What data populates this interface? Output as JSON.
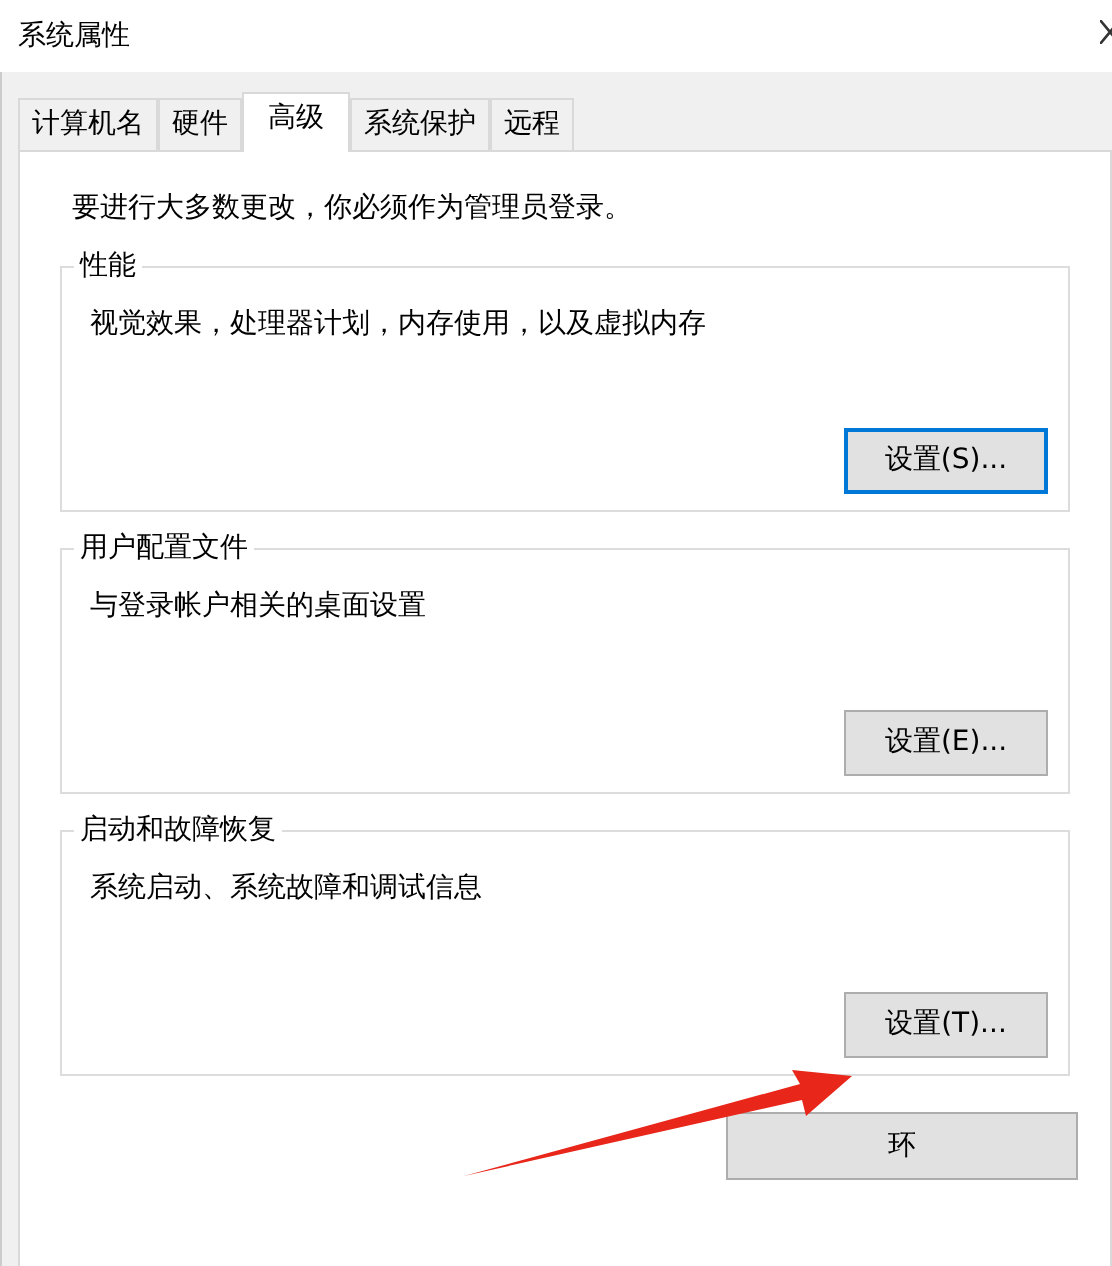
{
  "window": {
    "title": "系统属性"
  },
  "tabs": [
    {
      "label": "计算机名",
      "selected": false
    },
    {
      "label": "硬件",
      "selected": false
    },
    {
      "label": "高级",
      "selected": true
    },
    {
      "label": "系统保护",
      "selected": false
    },
    {
      "label": "远程",
      "selected": false
    }
  ],
  "notice": "要进行大多数更改，你必须作为管理员登录。",
  "groups": [
    {
      "title": "性能",
      "description": "视觉效果，处理器计划，内存使用，以及虚拟内存",
      "button": {
        "label": "设置(S)...",
        "focused": true
      }
    },
    {
      "title": "用户配置文件",
      "description": "与登录帐户相关的桌面设置",
      "button": {
        "label": "设置(E)...",
        "focused": false
      }
    },
    {
      "title": "启动和故障恢复",
      "description": "系统启动、系统故障和调试信息",
      "button": {
        "label": "设置(T)...",
        "focused": false
      }
    }
  ],
  "footer_button": {
    "label": "环"
  }
}
